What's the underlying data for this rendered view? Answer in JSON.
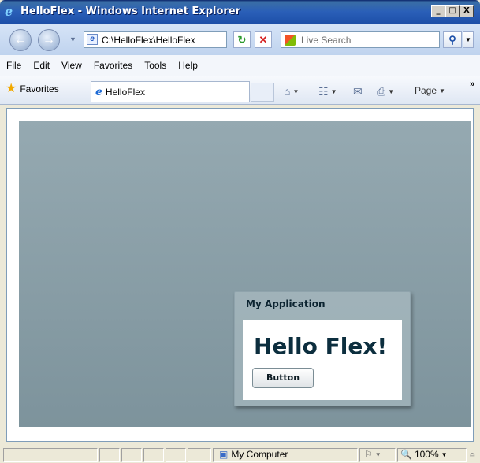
{
  "window": {
    "title": "HelloFlex - Windows Internet Explorer",
    "min": "_",
    "max": "□",
    "close": "X"
  },
  "nav": {
    "address": "C:\\HelloFlex\\HelloFlex",
    "search_placeholder": "Live Search"
  },
  "menu": {
    "items": [
      "File",
      "Edit",
      "View",
      "Favorites",
      "Tools",
      "Help"
    ]
  },
  "favbar": {
    "favorites_label": "Favorites",
    "tab_label": "HelloFlex",
    "page_label": "Page",
    "overflow": "»"
  },
  "app": {
    "panel_title": "My Application",
    "heading": "Hello Flex!",
    "button_label": "Button"
  },
  "status": {
    "zone": "My Computer",
    "zoom": "100%"
  }
}
